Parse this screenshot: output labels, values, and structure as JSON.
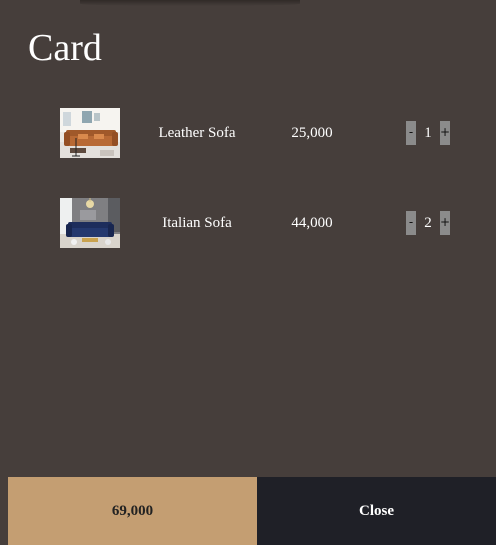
{
  "cart": {
    "title": "Card",
    "items": [
      {
        "name": "Leather Sofa",
        "price": "25,000",
        "quantity": "1",
        "minus_label": "-",
        "plus_label": "+",
        "image_icon": "leather-sofa-photo"
      },
      {
        "name": "Italian Sofa",
        "price": "44,000",
        "quantity": "2",
        "minus_label": "-",
        "plus_label": "+",
        "image_icon": "italian-sofa-photo"
      }
    ],
    "total": "69,000",
    "close_label": "Close"
  },
  "colors": {
    "panel_background": "#463e3b",
    "total_background": "#c49e72",
    "close_background": "#1f2027",
    "quantity_button": "#8b8b8b"
  }
}
